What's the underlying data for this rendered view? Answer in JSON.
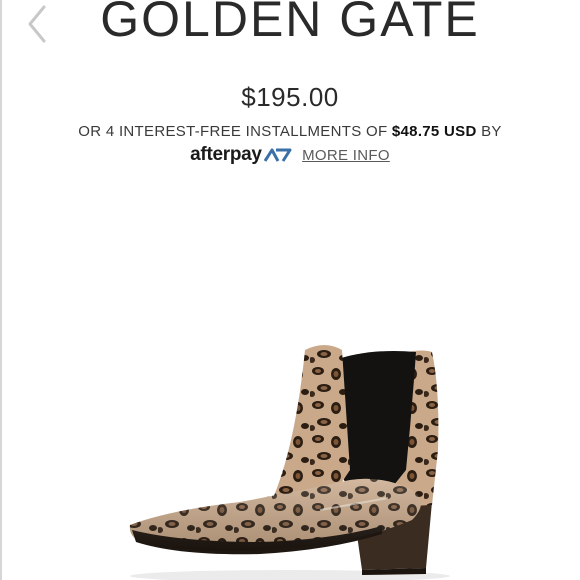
{
  "product": {
    "title": "GOLDEN GATE",
    "price": "$195.00",
    "installment_prefix": "OR 4 INTEREST-FREE INSTALLMENTS OF",
    "installment_amount": "$48.75 USD",
    "installment_suffix": "BY",
    "afterpay_brand": "afterpay",
    "more_info_label": "MORE INFO"
  },
  "icons": {
    "back": "chevron-left-icon",
    "afterpay_logo": "afterpay-arrows-icon"
  },
  "colors": {
    "background": "#ffffff",
    "text": "#2a2a2a",
    "afterpay_accent": "#3a6fa8"
  }
}
